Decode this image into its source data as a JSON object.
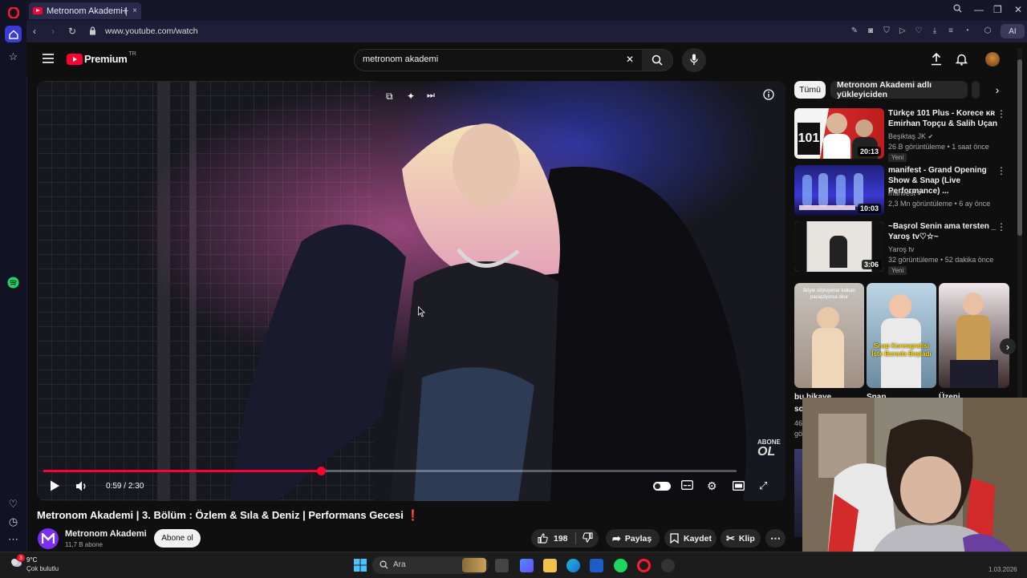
{
  "browser": {
    "tab_title": "Metronom Akademi | 3. B",
    "tab_close": "×",
    "new_tab": "+",
    "url": "www.youtube.com/watch",
    "ai_label": "AI"
  },
  "youtube": {
    "logo": "Premium",
    "logo_country": "TR",
    "search_value": "metronom akademi",
    "clear_glyph": "✕"
  },
  "player": {
    "time_current": "0:59",
    "time_separator": " / ",
    "time_total": "2:30",
    "progress": 0.4,
    "watermark_top": "ABONE",
    "watermark_bottom": "OL"
  },
  "video": {
    "title": "Metronom Akademi | 3. Bölüm : Özlem & Sıla & Deniz | Performans Gecesi",
    "title_mark": "❗",
    "channel_name": "Metronom Akademi",
    "subscribers": "11,7 B abone",
    "subscribe_label": "Abone ol",
    "likes": "198",
    "share_label": "Paylaş",
    "save_label": "Kaydet",
    "clip_label": "Klip"
  },
  "filters": {
    "all": "Tümü",
    "uploader": "Metronom Akademi adlı yükleyiciden"
  },
  "recommendations": [
    {
      "title": "Türkçe 101 Plus - Korece ᴋʀ Emirhan Topçu & Salih Uçan",
      "channel": "Beşiktaş JK",
      "meta": "26 B görüntüleme • 1 saat önce",
      "badge": "Yeni",
      "duration": "20:13"
    },
    {
      "title": "manifest - Grand Opening Show & Snap (Live Performance) ...",
      "channel": "manifest",
      "meta": "2,3 Mn görüntüleme • 6 ay önce",
      "badge": "",
      "duration": "10:03"
    },
    {
      "title": "~Başrol Senin ama tersten _ Yaroş tv♡☆~",
      "channel": "Yaroş tv",
      "meta": "32 görüntüleme • 52 dakika önce",
      "badge": "Yeni",
      "duration": "3:06"
    }
  ],
  "shorts": [
    {
      "title": "bu hikaye...",
      "sub": "sor",
      "caption": "Böyle söylüyorlar kalkan pacepliyorsa okur"
    },
    {
      "title": "Snap",
      "sub": "",
      "caption": "Snap Koreografisi İşte Burada Başladı"
    },
    {
      "title": "Üzeni",
      "sub": "",
      "caption": ""
    }
  ],
  "shorts_extra": {
    "views_a": "468",
    "views_b": "görü"
  },
  "taskbar": {
    "weather_temp": "9°C",
    "weather_desc": "Çok bulutlu",
    "weather_badge": "3",
    "search_placeholder": "Ara",
    "clock_date": "1.03.2026"
  }
}
